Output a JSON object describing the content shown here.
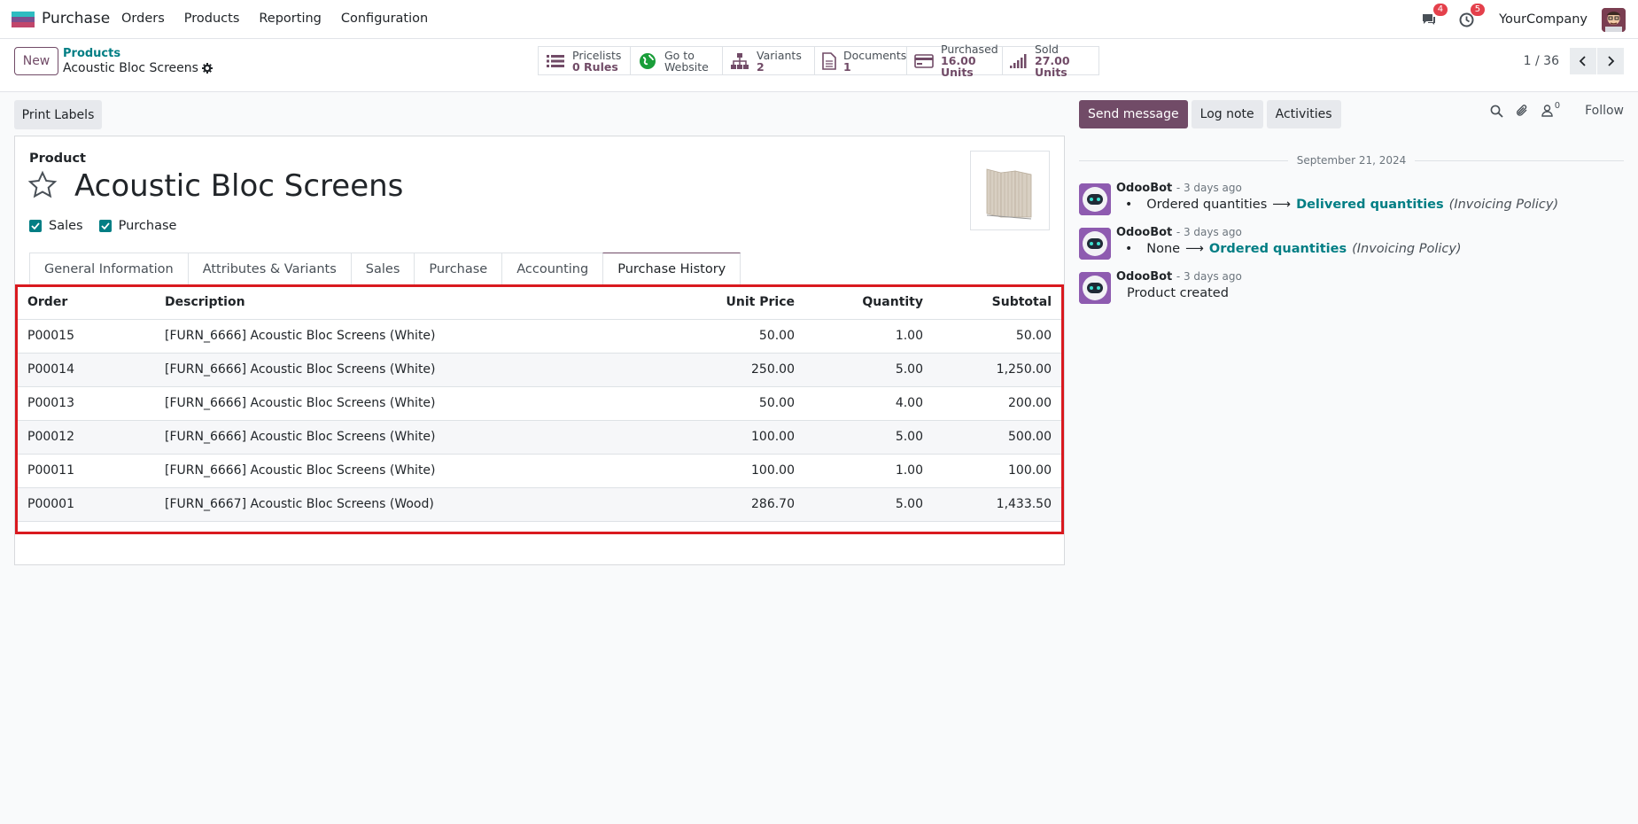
{
  "navbar": {
    "app_name": "Purchase",
    "menu": [
      "Orders",
      "Products",
      "Reporting",
      "Configuration"
    ],
    "messages_badge": "4",
    "activities_badge": "5",
    "company": "YourCompany"
  },
  "control": {
    "new_label": "New",
    "breadcrumb_parent": "Products",
    "breadcrumb_current": "Acoustic Bloc Screens",
    "smart_buttons": [
      {
        "line1": "Pricelists",
        "line2": "0 Rules",
        "icon": "list-icon"
      },
      {
        "line1": "Go to",
        "line2": "Website",
        "icon": "globe-icon"
      },
      {
        "line1": "Variants",
        "line2": "2",
        "icon": "sitemap-icon"
      },
      {
        "line1": "Documents",
        "line2": "1",
        "icon": "file-icon"
      },
      {
        "line1": "Purchased",
        "line2": "16.00 Units",
        "icon": "credit-card-icon"
      },
      {
        "line1": "Sold",
        "line2": "27.00 Units",
        "icon": "signal-icon"
      }
    ],
    "pager": "1 / 36"
  },
  "form": {
    "print_labels": "Print Labels",
    "product_label": "Product",
    "product_name": "Acoustic Bloc Screens",
    "check_sales": "Sales",
    "check_purchase": "Purchase",
    "tabs": [
      "General Information",
      "Attributes & Variants",
      "Sales",
      "Purchase",
      "Accounting",
      "Purchase History"
    ],
    "active_tab": "Purchase History"
  },
  "table": {
    "headers": [
      "Order",
      "Description",
      "Unit Price",
      "Quantity",
      "Subtotal"
    ],
    "rows": [
      [
        "P00015",
        "[FURN_6666] Acoustic Bloc Screens (White)",
        "50.00",
        "1.00",
        "50.00"
      ],
      [
        "P00014",
        "[FURN_6666] Acoustic Bloc Screens (White)",
        "250.00",
        "5.00",
        "1,250.00"
      ],
      [
        "P00013",
        "[FURN_6666] Acoustic Bloc Screens (White)",
        "50.00",
        "4.00",
        "200.00"
      ],
      [
        "P00012",
        "[FURN_6666] Acoustic Bloc Screens (White)",
        "100.00",
        "5.00",
        "500.00"
      ],
      [
        "P00011",
        "[FURN_6666] Acoustic Bloc Screens (White)",
        "100.00",
        "1.00",
        "100.00"
      ],
      [
        "P00001",
        "[FURN_6667] Acoustic Bloc Screens (Wood)",
        "286.70",
        "5.00",
        "1,433.50"
      ]
    ]
  },
  "chatter": {
    "send_message": "Send message",
    "log_note": "Log note",
    "activities": "Activities",
    "followers_count": "0",
    "follow": "Follow",
    "date": "September 21, 2024",
    "messages": [
      {
        "author": "OdooBot",
        "time": "- 3 days ago",
        "from": "Ordered quantities",
        "arrow": "⟶",
        "to": "Delivered quantities",
        "field": "(Invoicing Policy)"
      },
      {
        "author": "OdooBot",
        "time": "- 3 days ago",
        "from": "None",
        "arrow": "⟶",
        "to": "Ordered quantities",
        "field": "(Invoicing Policy)"
      },
      {
        "author": "OdooBot",
        "time": "- 3 days ago",
        "text": "Product created"
      }
    ]
  }
}
